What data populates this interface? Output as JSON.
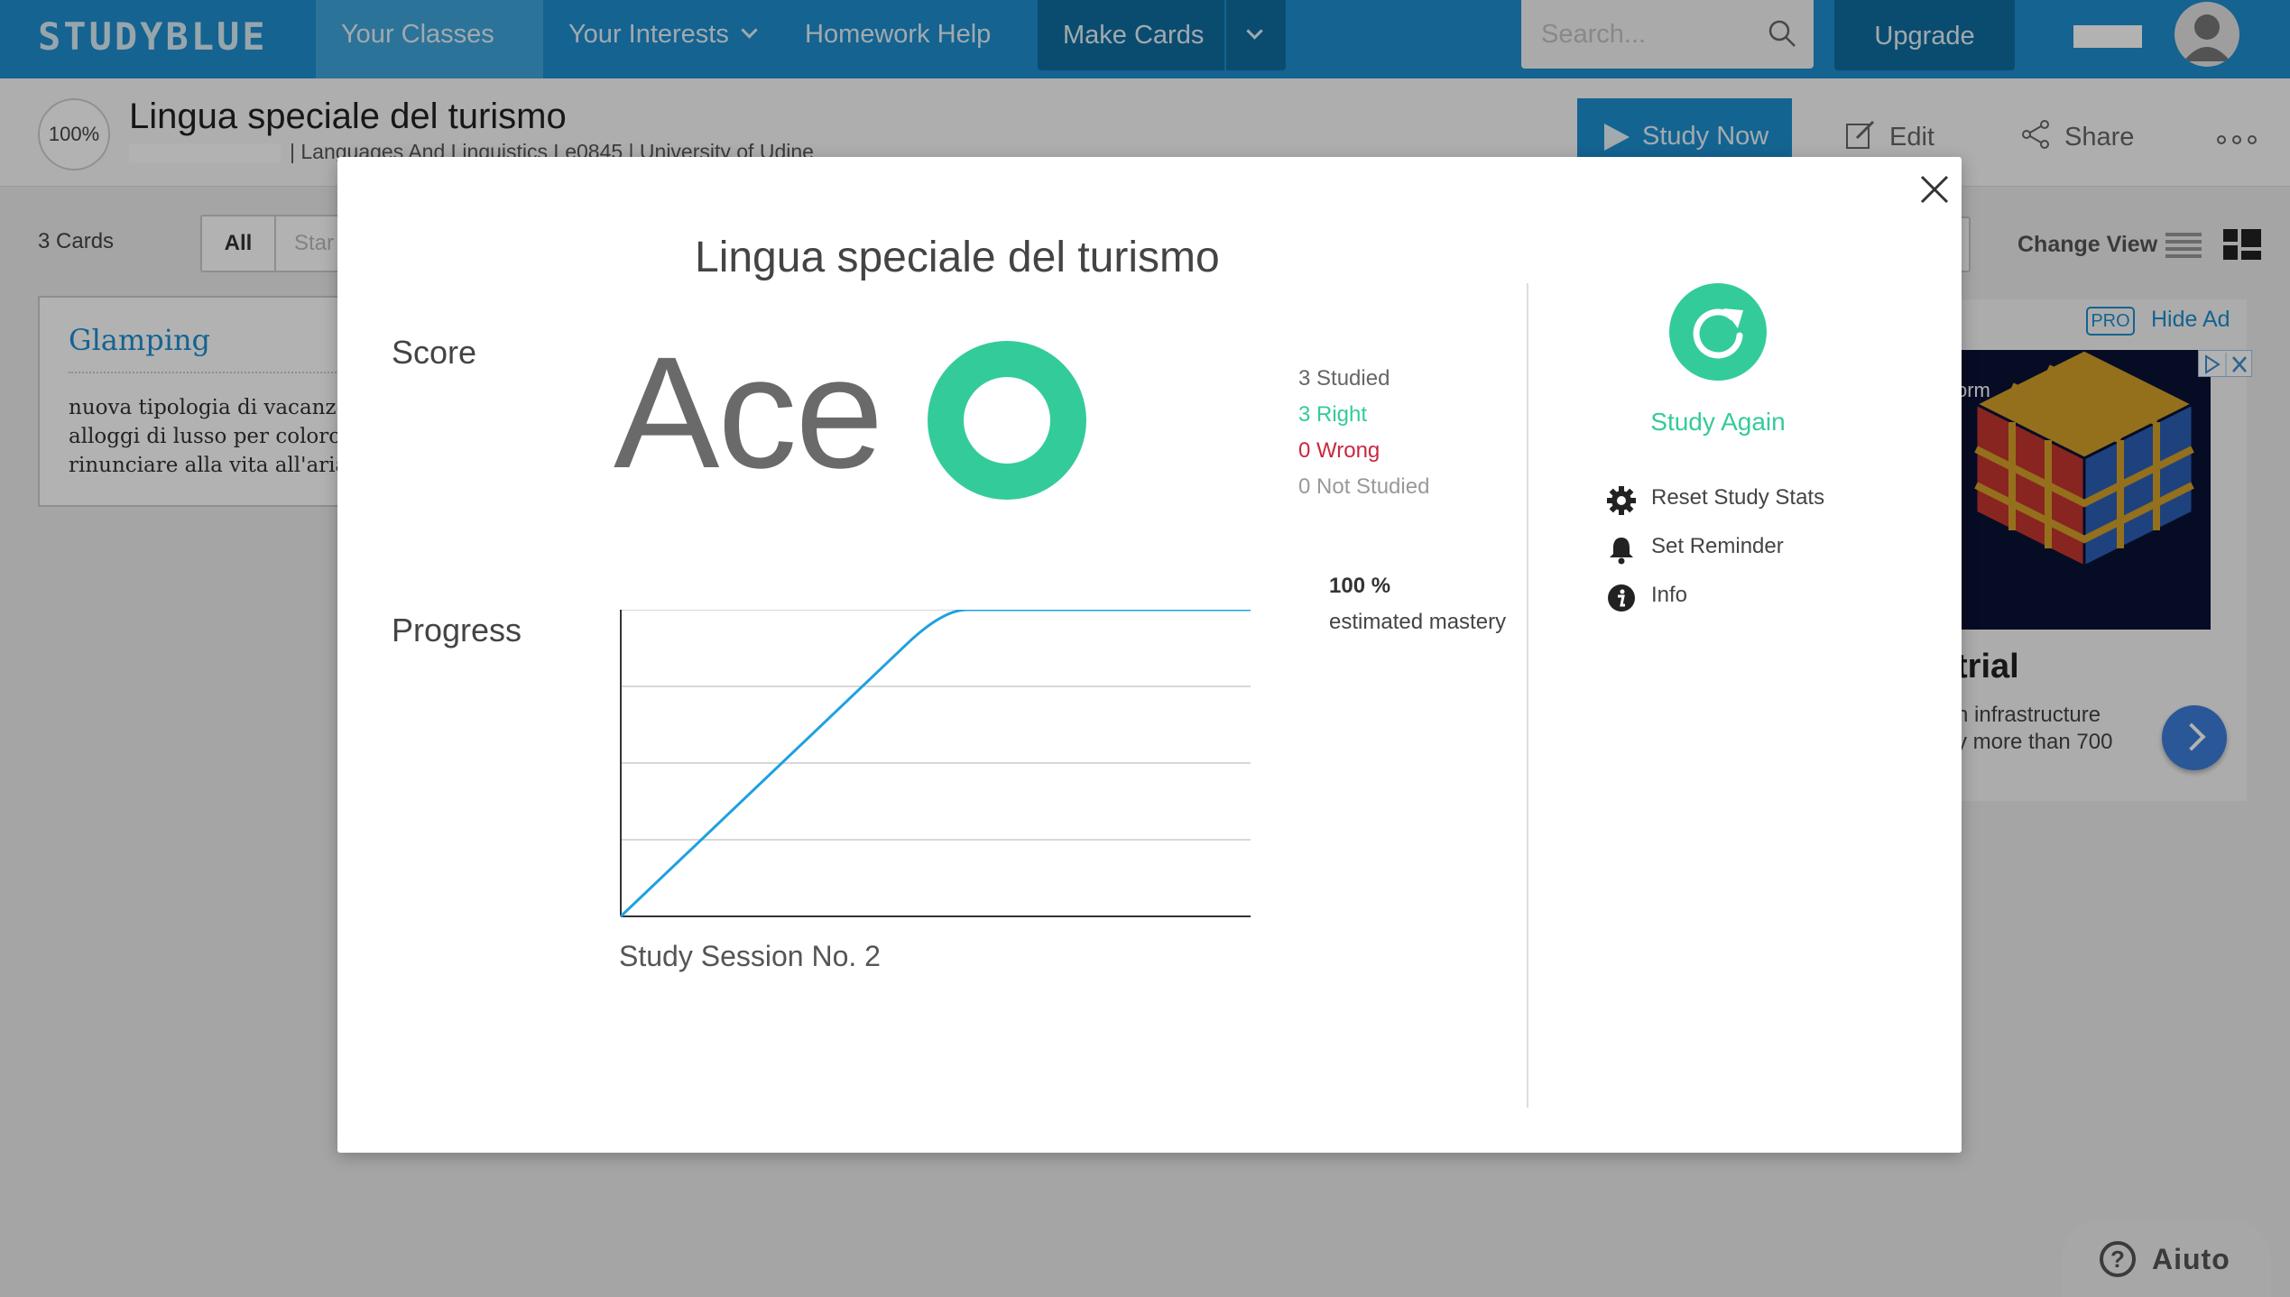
{
  "app": {
    "logo": "STUDYBLUE"
  },
  "nav": {
    "your_classes": "Your Classes",
    "your_interests": "Your Interests",
    "homework_help": "Homework Help",
    "make_cards": "Make Cards",
    "search_placeholder": "Search...",
    "upgrade": "Upgrade"
  },
  "deck": {
    "mastery": "100%",
    "title": "Lingua speciale del turismo",
    "subtitle": "| Languages And Linguistics Le0845 | University of Udine",
    "study_now": "Study Now",
    "edit": "Edit",
    "share": "Share"
  },
  "filters": {
    "count": "3 Cards",
    "all": "All",
    "starred": "Star",
    "change_view": "Change View"
  },
  "card": {
    "term": "Glamping",
    "definition": [
      "nuova tipologia di vacanze",
      "alloggi di lusso per coloro",
      "rinunciare alla vita all'aria"
    ]
  },
  "ad": {
    "pro": "PRO",
    "hide": "Hide Ad",
    "image_text": "orm",
    "headline": "trial",
    "body": [
      "n infrastructure",
      "y more than 700"
    ]
  },
  "help": {
    "label": "Aiuto"
  },
  "modal": {
    "title": "Lingua speciale del turismo",
    "score_label": "Score",
    "score": "Ace",
    "stats": {
      "studied": "3 Studied",
      "right": "3 Right",
      "wrong": "0 Wrong",
      "not_studied": "0 Not Studied"
    },
    "progress_label": "Progress",
    "mastery_pct": "100 %",
    "mastery_label": "estimated mastery",
    "study_again": "Study Again",
    "menu": {
      "reset": "Reset Study Stats",
      "reminder": "Set Reminder",
      "info": "Info"
    },
    "colors": {
      "accent": "#34cb9b",
      "wrong": "#c9283e",
      "line": "#1da1e0"
    }
  },
  "chart_data": {
    "type": "line",
    "xlabel": "Study Session No. 2",
    "ylabel": "",
    "ylim": [
      0,
      100
    ],
    "x": [
      0,
      0.45,
      0.55,
      1.0
    ],
    "series": [
      {
        "values": [
          0,
          88,
          100,
          100
        ]
      }
    ],
    "gridlines": [
      25,
      50,
      75,
      100
    ]
  }
}
